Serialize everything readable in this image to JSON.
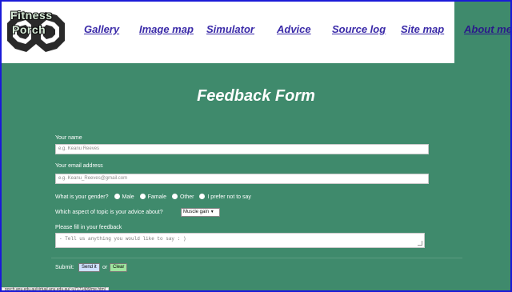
{
  "logo": {
    "line1": "Fitness",
    "line2": "Porch"
  },
  "nav": {
    "items": [
      {
        "label": "Gallery"
      },
      {
        "label": "Image map"
      },
      {
        "label": "Simulator"
      },
      {
        "label": "Advice"
      },
      {
        "label": "Source log"
      },
      {
        "label": "Site map"
      }
    ],
    "active": {
      "label": "About me"
    }
  },
  "colors": {
    "page_bg": "#3f8a6c",
    "nav_link": "#3a2aa8",
    "header_bg": "#ffffff"
  },
  "form": {
    "title": "Feedback Form",
    "name": {
      "label": "Your name",
      "placeholder": "e.g. Keanu Reeves"
    },
    "email": {
      "label": "Your email address",
      "placeholder": "e.g. Keanu_Reeves@gmail.com"
    },
    "gender": {
      "label": "What is your gender?",
      "options": [
        "Male",
        "Famale",
        "Other",
        "I prefer not to say"
      ]
    },
    "topic": {
      "label": "Which aspect of topic is your advice about?",
      "selected": "Muscle gain"
    },
    "feedback": {
      "label": "Please fill in your feedback",
      "placeholder": "- Tell us anything you would like to say : )"
    },
    "submit": {
      "label": "Submit:",
      "send": "Send it",
      "or": "or",
      "clear": "Clear"
    }
  },
  "status_bar": {
    "url": "porch.anu.edu.au/virtual.anu.edu.au/~u7171409/me.html"
  }
}
